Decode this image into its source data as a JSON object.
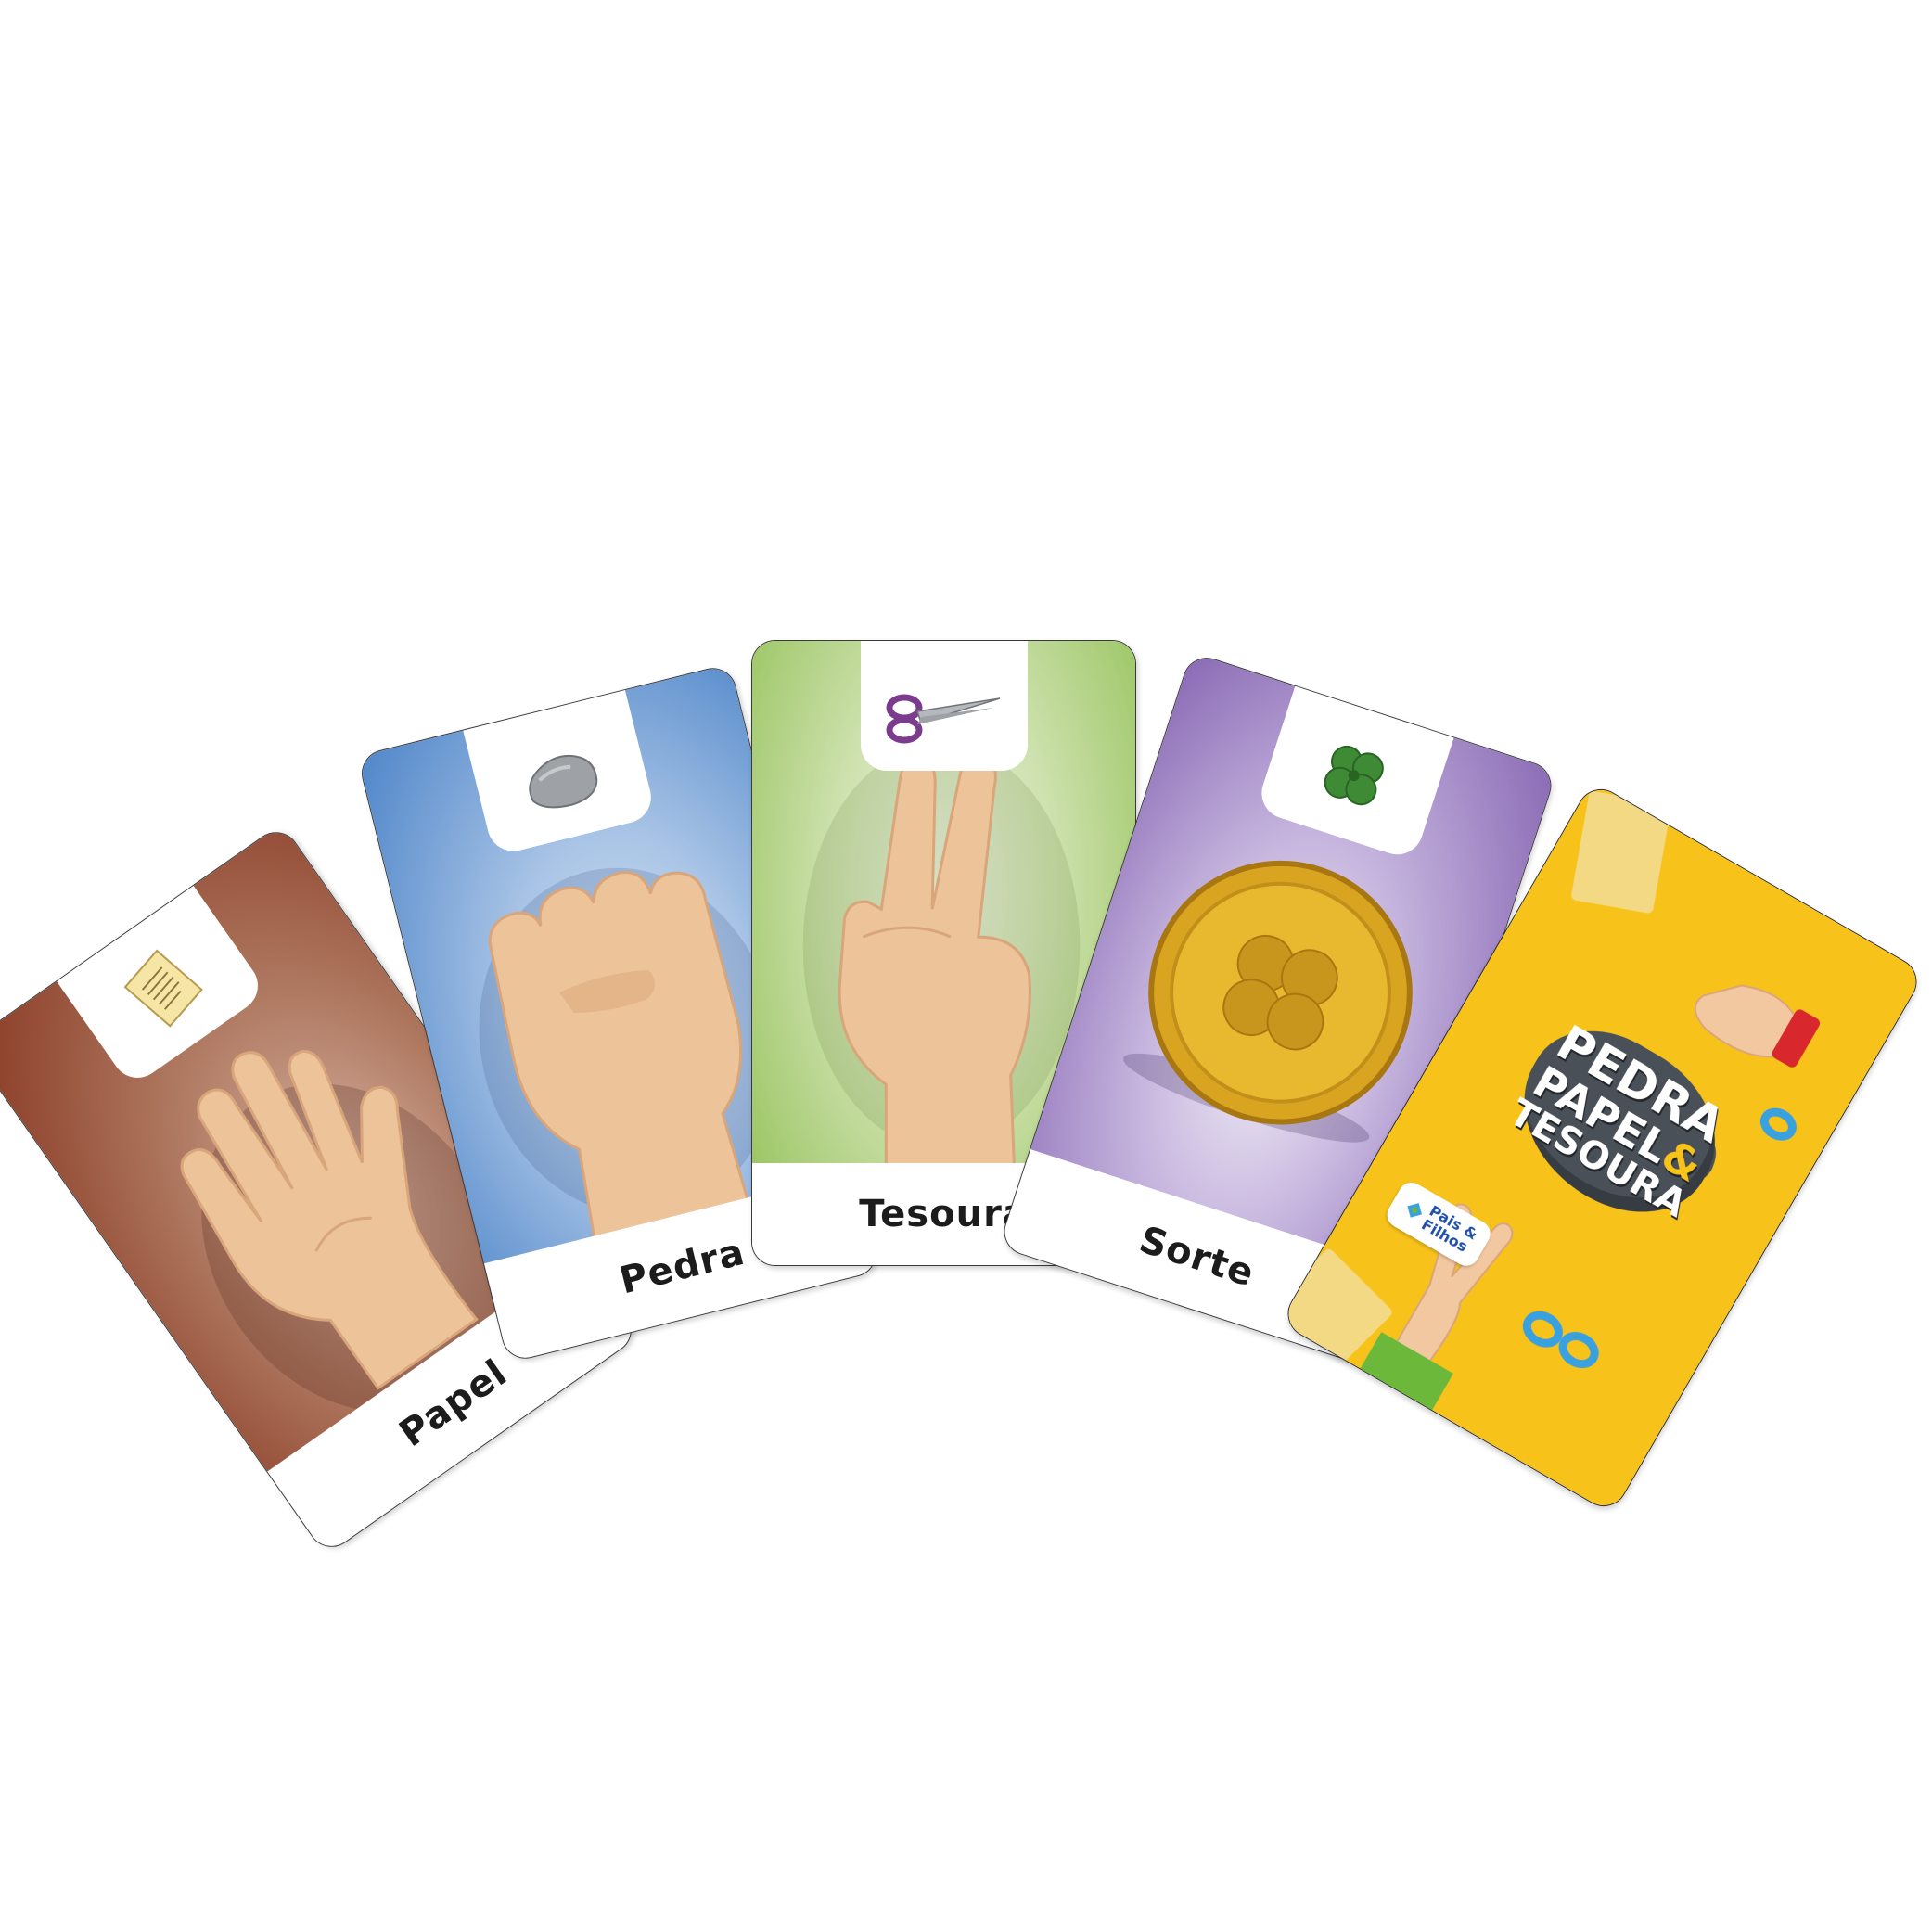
{
  "cards": [
    {
      "label": "Papel",
      "icon": "paper-icon",
      "color_top": "#8a3b25",
      "color_mid": "#c9957f"
    },
    {
      "label": "Pedra",
      "icon": "rock-icon",
      "color_top": "#4f86c9",
      "color_mid": "#b8d0ee"
    },
    {
      "label": "Tesoura",
      "icon": "scissors-icon",
      "color_top": "#8fbf52",
      "color_mid": "#e2eed0"
    },
    {
      "label": "Sorte",
      "icon": "clover-icon",
      "color_top": "#8a6ab5",
      "color_mid": "#e3dbee"
    }
  ],
  "back": {
    "title_line1": "PEDRA",
    "title_line2": "PAPEL",
    "title_amp": "&",
    "title_line3": "TESOURA",
    "brand_line1": "Pais",
    "brand_amp": "&",
    "brand_line2": "Filhos",
    "color_bg": "#f7c21a"
  }
}
